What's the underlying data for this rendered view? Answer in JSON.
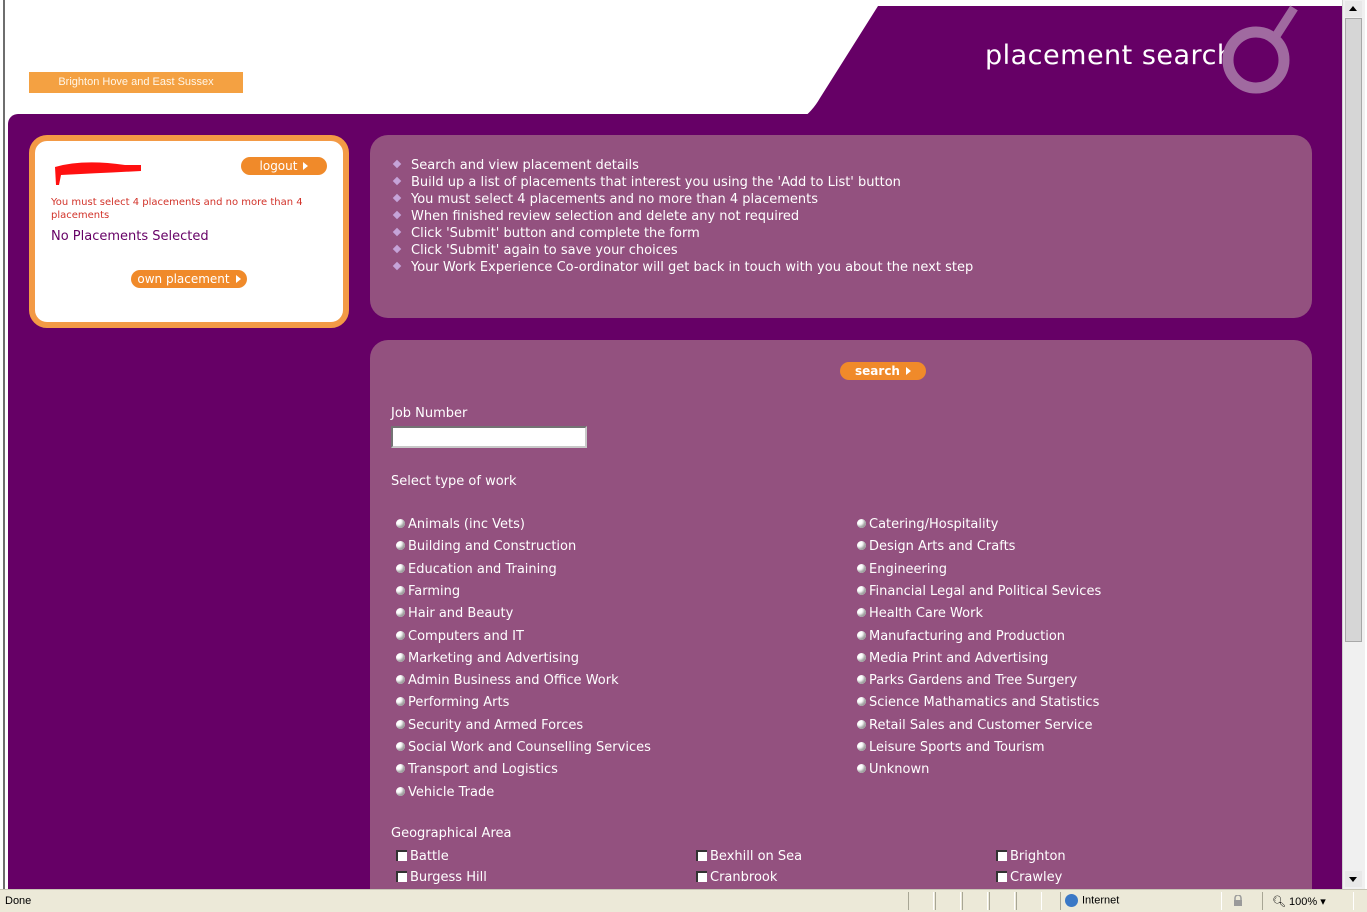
{
  "header": {
    "organisation": "Brighton Hove and East Sussex",
    "title": "placement search"
  },
  "user_panel": {
    "logout_label": "logout",
    "warning": "You must select 4 placements and no more than 4 placements",
    "selection_status": "No Placements Selected",
    "own_placement_label": "own placement"
  },
  "instructions": [
    "Search and view placement details",
    "Build up a list of placements that interest you using the 'Add to List' button",
    "You must select 4 placements and no more than 4 placements",
    "When finished review selection and delete any not required",
    "Click 'Submit' button and complete the form",
    "Click 'Submit' again to save your choices",
    "Your Work Experience Co-ordinator will get back in touch with you about the next step"
  ],
  "search": {
    "button_label": "search",
    "job_number_label": "Job Number",
    "job_number_value": "",
    "work_type_label": "Select type of work",
    "work_types_left": [
      "Animals (inc Vets)",
      "Building and Construction",
      "Education and Training",
      "Farming",
      "Hair and Beauty",
      "Computers and IT",
      "Marketing and Advertising",
      "Admin Business and Office Work",
      "Performing Arts",
      "Security and Armed Forces",
      "Social Work and Counselling Services",
      "Transport and Logistics",
      "Vehicle Trade"
    ],
    "work_types_right": [
      "Catering/Hospitality",
      "Design Arts and Crafts",
      "Engineering",
      "Financial Legal and Political Sevices",
      "Health Care Work",
      "Manufacturing and Production",
      "Media Print and Advertising",
      "Parks Gardens and Tree Surgery",
      "Science Mathamatics and Statistics",
      "Retail Sales and Customer Service",
      "Leisure Sports and Tourism",
      "Unknown"
    ],
    "geo_label": "Geographical Area",
    "areas": [
      [
        "Battle",
        "Bexhill on Sea",
        "Brighton"
      ],
      [
        "Burgess Hill",
        "Cranbrook",
        "Crawley"
      ]
    ]
  },
  "statusbar": {
    "status": "Done",
    "zone": "Internet",
    "zoom": "100%"
  },
  "colors": {
    "purple": "#660066",
    "panel": "#93517f",
    "orange": "#f08a2a"
  }
}
